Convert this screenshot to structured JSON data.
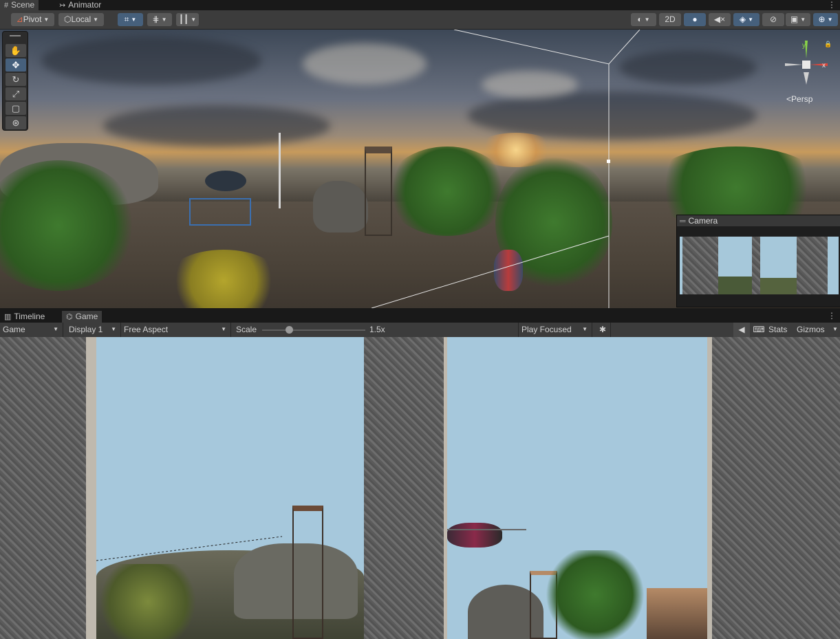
{
  "top_tabs": [
    {
      "label": "Scene",
      "icon": "grid-icon",
      "active": true
    },
    {
      "label": "Animator",
      "icon": "animator-icon",
      "active": false
    }
  ],
  "scene_toolbar": {
    "pivot_label": "Pivot",
    "local_label": "Local",
    "mode_2d_label": "2D"
  },
  "scene_view": {
    "view_mode_label": "Persp",
    "axis_labels": {
      "y": "y",
      "x": "x"
    }
  },
  "camera_preview": {
    "title": "Camera"
  },
  "bottom_tabs": [
    {
      "label": "Timeline",
      "icon": "timeline-icon",
      "active": false
    },
    {
      "label": "Game",
      "icon": "gamepad-icon",
      "active": true
    }
  ],
  "game_toolbar": {
    "view_select": "Game",
    "display_select": "Display 1",
    "aspect_select": "Free Aspect",
    "scale_label": "Scale",
    "scale_value": "1.5x",
    "scale_fraction": 0.26,
    "play_mode_select": "Play Focused",
    "stats_label": "Stats",
    "gizmos_label": "Gizmos"
  },
  "colors": {
    "accent_active": "#46607c",
    "panel_bg": "#3c3c3c",
    "sky": "#a6c8dc"
  }
}
